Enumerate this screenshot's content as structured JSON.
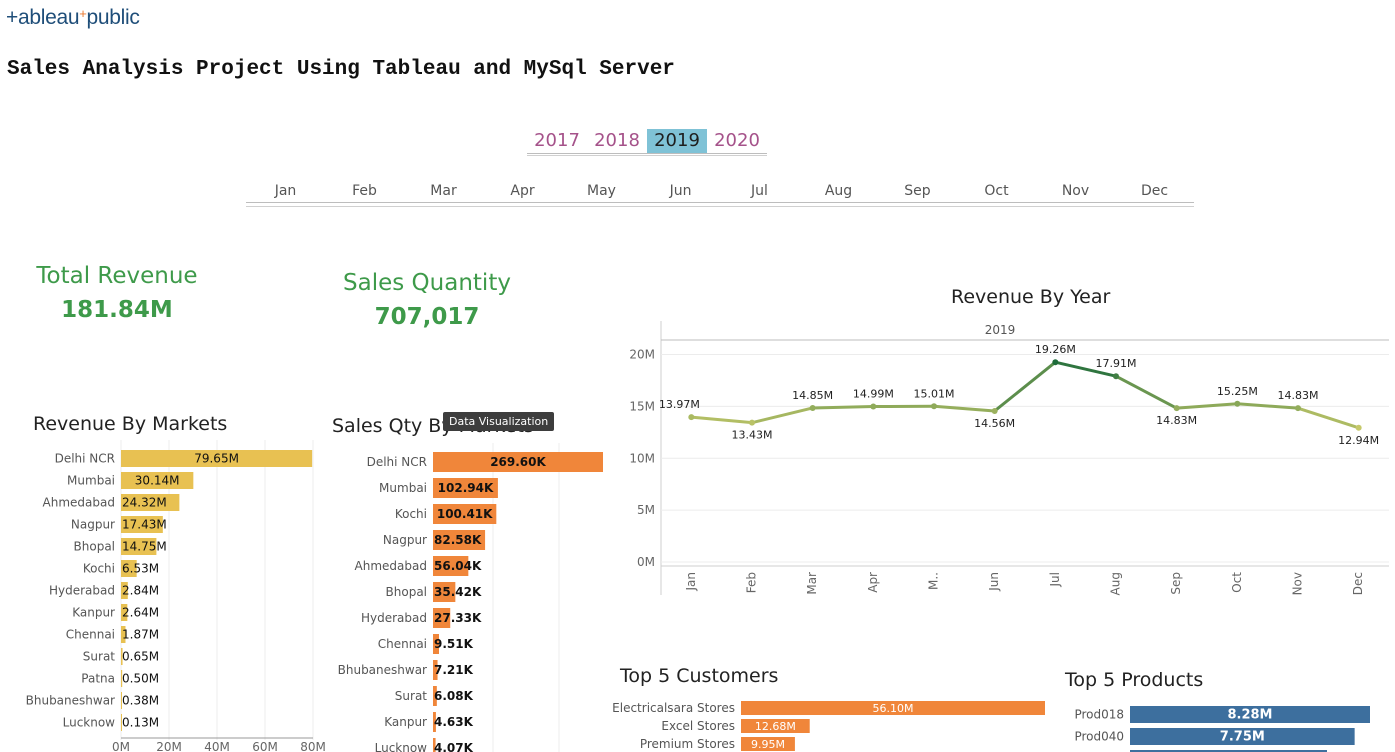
{
  "header": {
    "logo_text": "+ableau",
    "logo_spark": "+",
    "logo_public": "public",
    "title": "Sales Analysis Project Using Tableau and MySql Server"
  },
  "filters": {
    "years": [
      "2017",
      "2018",
      "2019",
      "2020"
    ],
    "selected_year": "2019",
    "months": [
      "Jan",
      "Feb",
      "Mar",
      "Apr",
      "May",
      "Jun",
      "Jul",
      "Aug",
      "Sep",
      "Oct",
      "Nov",
      "Dec"
    ]
  },
  "kpis": {
    "total_revenue": {
      "label": "Total Revenue",
      "value": "181.84M"
    },
    "sales_quantity": {
      "label": "Sales Quantity",
      "value": "707,017"
    }
  },
  "tooltip": "Data Visualization",
  "colors": {
    "kpi": "#3e9a4a",
    "revenue_bar": "#e8c152",
    "qty_bar": "#f0863a",
    "customer_bar": "#f0863a",
    "product_bar": "#3d6f9e",
    "line_low": "#c6c96a",
    "line_high": "#1d6b3a",
    "year_selected": "#7fc2d6",
    "year_text": "#a5528a"
  },
  "chart_data": [
    {
      "id": "revenue_by_markets",
      "type": "bar",
      "orientation": "horizontal",
      "title": "Revenue By Markets",
      "categories": [
        "Delhi NCR",
        "Mumbai",
        "Ahmedabad",
        "Nagpur",
        "Bhopal",
        "Kochi",
        "Hyderabad",
        "Kanpur",
        "Chennai",
        "Surat",
        "Patna",
        "Bhubaneshwar",
        "Lucknow"
      ],
      "values": [
        79.65,
        30.14,
        24.32,
        17.43,
        14.75,
        6.53,
        2.84,
        2.64,
        1.87,
        0.65,
        0.5,
        0.38,
        0.13
      ],
      "labels": [
        "79.65M",
        "30.14M",
        "24.32M",
        "17.43M",
        "14.75M",
        "6.53M",
        "2.84M",
        "2.64M",
        "1.87M",
        "0.65M",
        "0.50M",
        "0.38M",
        "0.13M"
      ],
      "xticks": [
        "0M",
        "20M",
        "40M",
        "60M",
        "80M"
      ],
      "xlim": [
        0,
        80
      ]
    },
    {
      "id": "sales_qty_by_markets",
      "type": "bar",
      "orientation": "horizontal",
      "title": "Sales Qty By Markets",
      "categories": [
        "Delhi NCR",
        "Mumbai",
        "Kochi",
        "Nagpur",
        "Ahmedabad",
        "Bhopal",
        "Hyderabad",
        "Chennai",
        "Bhubaneshwar",
        "Surat",
        "Kanpur",
        "Lucknow"
      ],
      "values": [
        269.6,
        102.94,
        100.41,
        82.58,
        56.04,
        35.42,
        27.33,
        9.51,
        7.21,
        6.08,
        4.63,
        4.07
      ],
      "labels": [
        "269.60K",
        "102.94K",
        "100.41K",
        "82.58K",
        "56.04K",
        "35.42K",
        "27.33K",
        "9.51K",
        "7.21K",
        "6.08K",
        "4.63K",
        "4.07K"
      ],
      "xlim": [
        0,
        269.6
      ]
    },
    {
      "id": "revenue_by_year",
      "type": "line",
      "title": "Revenue By Year",
      "panel_label": "2019",
      "categories": [
        "Jan",
        "Feb",
        "Mar",
        "Apr",
        "M..",
        "Jun",
        "Jul",
        "Aug",
        "Sep",
        "Oct",
        "Nov",
        "Dec"
      ],
      "values": [
        13.97,
        13.43,
        14.85,
        14.99,
        15.01,
        14.56,
        19.26,
        17.91,
        14.83,
        15.25,
        14.83,
        12.94
      ],
      "labels": [
        "13.97M",
        "13.43M",
        "14.85M",
        "14.99M",
        "15.01M",
        "14.56M",
        "19.26M",
        "17.91M",
        "14.83M",
        "15.25M",
        "14.83M",
        "12.94M"
      ],
      "yticks": [
        "0M",
        "5M",
        "10M",
        "15M",
        "20M"
      ],
      "ylim": [
        0,
        21.4
      ],
      "grid": true
    },
    {
      "id": "top_5_customers",
      "type": "bar",
      "orientation": "horizontal",
      "title": "Top 5 Customers",
      "categories": [
        "Electricalsara Stores",
        "Excel Stores",
        "Premium Stores"
      ],
      "values": [
        56.1,
        12.68,
        9.95
      ],
      "labels": [
        "56.10M",
        "12.68M",
        "9.95M"
      ],
      "xlim": [
        0,
        56.1
      ]
    },
    {
      "id": "top_5_products",
      "type": "bar",
      "orientation": "horizontal",
      "title": "Top 5 Products",
      "categories": [
        "Prod018",
        "Prod040"
      ],
      "values": [
        8.28,
        7.75
      ],
      "labels": [
        "8.28M",
        "7.75M"
      ],
      "xlim": [
        0,
        8.28
      ]
    }
  ]
}
